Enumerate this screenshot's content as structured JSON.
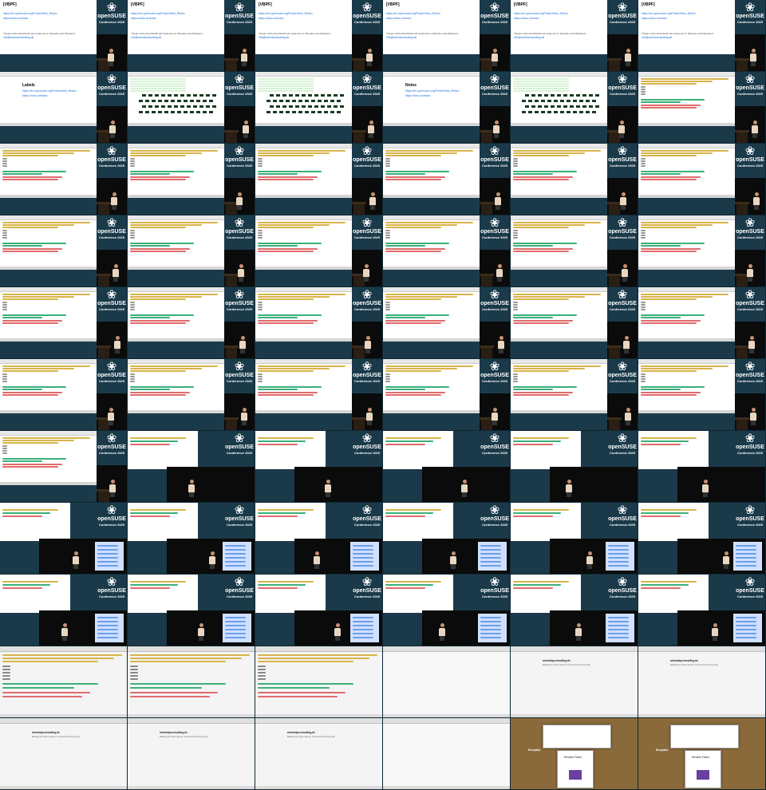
{
  "brand": {
    "wordmark": "openSUSE",
    "conference": "Conference 2025",
    "gecko_icon": "gecko-icon"
  },
  "slides": {
    "links_title": "[VBPF]",
    "link1": "https://en.opensuse.org/Portal:Hello_Redox",
    "link2": "https://docs.rs/redox",
    "author_line": "Things I write about/build and implement in Wesoden and Weekend",
    "contact": "info@ariestconsulting.de",
    "labels_title": "Labels",
    "notes_title": "Notes",
    "site": "ariestedpconsulting.de",
    "site_sub": "Building the Open Source. Trust and the Community",
    "dialog_title": "Rename Folder",
    "project_label": "Reception"
  },
  "colors": {
    "background": "#1a3a4a",
    "link": "#1a6fd1",
    "green_row": "#3bb07a",
    "yellow_row": "#d8b44a",
    "red_row": "#e06b6b",
    "blue_row": "#6d9fe8"
  },
  "tiles": [
    "links",
    "links",
    "links",
    "links",
    "links",
    "links",
    "labels",
    "grid",
    "grid",
    "notes",
    "grid",
    "diff",
    "diff",
    "diff",
    "diff",
    "diff",
    "diff",
    "diff",
    "diff",
    "diff",
    "diff",
    "diff",
    "diff",
    "diff",
    "diff",
    "diff",
    "diff",
    "diff",
    "diff",
    "diff",
    "diff",
    "diff",
    "diff",
    "diff",
    "diff",
    "diff",
    "diff",
    "bigcam",
    "bigcam",
    "bigcam",
    "bigcam",
    "bigcam",
    "screen",
    "screen",
    "screen",
    "screen",
    "screen",
    "screen",
    "screen",
    "screen",
    "screen",
    "screen",
    "screen",
    "screen",
    "editor",
    "editor",
    "editor",
    "blank",
    "site",
    "site",
    "site",
    "site",
    "site",
    "blank",
    "dialog",
    "dialog"
  ]
}
